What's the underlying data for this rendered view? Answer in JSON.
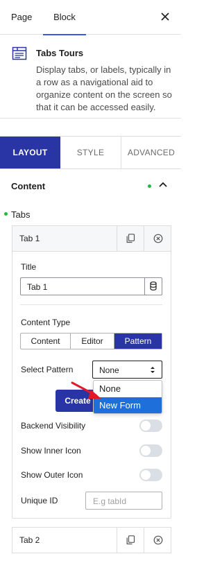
{
  "header": {
    "tabs": [
      {
        "label": "Page",
        "active": false
      },
      {
        "label": "Block",
        "active": true
      }
    ],
    "accent": "#3858e9"
  },
  "block": {
    "title": "Tabs Tours",
    "description": "Display tabs, or labels, typically in a row as a navigational aid to organize content on the screen so that it can be accessed easily."
  },
  "settings_tabs": {
    "items": [
      "LAYOUT",
      "STYLE",
      "ADVANCED"
    ],
    "active": "LAYOUT",
    "active_color": "#2a35a5"
  },
  "content_section": {
    "title": "Content",
    "expanded": true
  },
  "tabs_field": {
    "label": "Tabs",
    "items": [
      {
        "label": "Tab 1",
        "expanded": true,
        "title_label": "Title",
        "title_value": "Tab 1",
        "content_type_label": "Content Type",
        "content_type_options": [
          "Content",
          "Editor",
          "Pattern"
        ],
        "content_type_selected": "Pattern",
        "select_pattern_label": "Select Pattern",
        "select_pattern_value": "None",
        "pattern_options": [
          "None",
          "New Form"
        ],
        "pattern_highlighted": "New Form",
        "create_button_label": "Create",
        "backend_visibility_label": "Backend Visibility",
        "backend_visibility": false,
        "show_inner_icon_label": "Show Inner Icon",
        "show_inner_icon": false,
        "show_outer_icon_label": "Show Outer Icon",
        "show_outer_icon": false,
        "unique_id_label": "Unique ID",
        "unique_id_placeholder": "E.g tabId"
      },
      {
        "label": "Tab 2",
        "expanded": false
      }
    ]
  },
  "icons": [
    "close-icon",
    "tabs-block-icon",
    "chevron-up-icon",
    "copy-icon",
    "remove-circle-icon",
    "database-icon",
    "select-updown-icon",
    "annotation-arrow-icon"
  ],
  "colors": {
    "primary": "#2a35a5",
    "highlight": "#1e6fd9",
    "status_dot": "#25b541",
    "annotation_arrow": "#e0182a"
  }
}
